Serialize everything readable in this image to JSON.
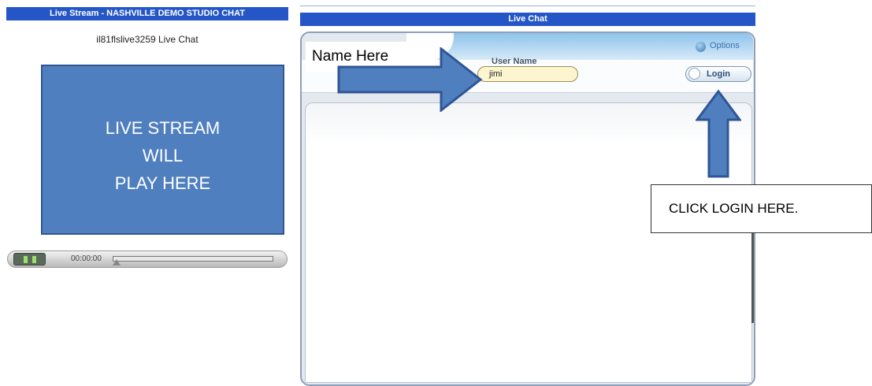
{
  "left_panel": {
    "header": "Live Stream - NASHVILLE DEMO STUDIO CHAT",
    "subtitle": "il81flslive3259 Live Chat",
    "video_placeholder": [
      "LIVE STREAM",
      "WILL",
      "PLAY HERE"
    ],
    "player": {
      "time": "00:00:00",
      "progress": 0
    }
  },
  "chat_panel": {
    "header": "Live Chat",
    "options_label": "Options",
    "user_name_label": "User Name",
    "user_name_value": "jimi",
    "login_label": "Login"
  },
  "annotations": {
    "name_here": "Name Here",
    "callout": "CLICK LOGIN HERE."
  },
  "colors": {
    "header_blue": "#2456c8",
    "annotation_blue": "#4f7fbf",
    "input_yellow": "#fdf5cf"
  }
}
